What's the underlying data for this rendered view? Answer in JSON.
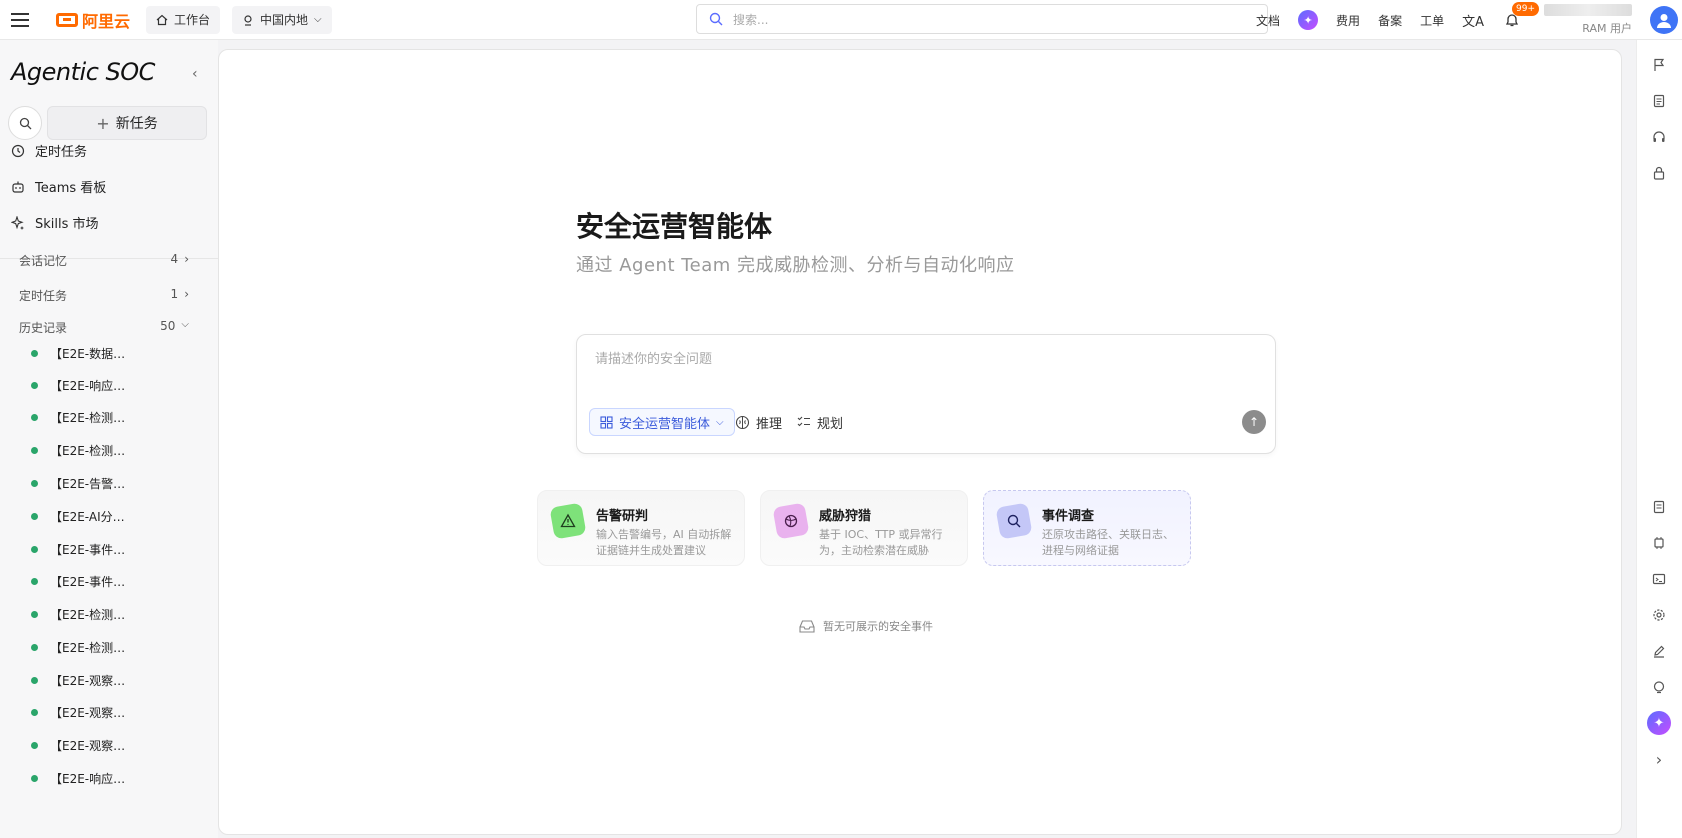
{
  "topbar": {
    "brand": "阿里云",
    "workbench": "工作台",
    "region": "中国内地",
    "search_placeholder": "搜索...",
    "links": [
      "文档",
      "费用",
      "备案",
      "工单"
    ],
    "notifications": "99+",
    "user_role": "RAM 用户"
  },
  "sidebar": {
    "title": "Agentic SOC",
    "new_task": "新任务",
    "nav": [
      {
        "label": "定时任务",
        "icon": "clock-icon"
      },
      {
        "label": "Teams 看板",
        "icon": "robot-icon"
      },
      {
        "label": "Skills 市场",
        "icon": "sparkle-icon"
      }
    ],
    "sections": [
      {
        "label": "会话记忆",
        "count": "4"
      },
      {
        "label": "定时任务",
        "count": "1"
      },
      {
        "label": "历史记录",
        "count": "50"
      }
    ],
    "history": [
      "【E2E-数据…",
      "【E2E-响应…",
      "【E2E-检测…",
      "【E2E-检测…",
      "【E2E-告警…",
      "【E2E-AI分…",
      "【E2E-事件…",
      "【E2E-事件…",
      "【E2E-检测…",
      "【E2E-检测…",
      "【E2E-观察…",
      "【E2E-观察…",
      "【E2E-观察…",
      "【E2E-响应…"
    ]
  },
  "main": {
    "title": "安全运营智能体",
    "subtitle": "通过 Agent Team 完成威胁检测、分析与自动化响应",
    "input_placeholder": "请描述你的安全问题",
    "agent_select": "安全运营智能体",
    "reasoning": "推理",
    "planning": "规划",
    "cards": [
      {
        "title": "告警研判",
        "desc": "输入告警编号，AI 自动拆解证据链并生成处置建议",
        "icon": "warning-icon",
        "color": "#7ee27a"
      },
      {
        "title": "威胁狩猎",
        "desc": "基于 IOC、TTP 或异常行为，主动检索潜在威胁",
        "icon": "globe-icon",
        "color": "#e9b2ee"
      },
      {
        "title": "事件调查",
        "desc": "还原攻击路径、关联日志、进程与网络证据",
        "icon": "search-icon",
        "color": "#c4c7f7"
      }
    ],
    "empty_note": "暂无可展示的安全事件"
  },
  "colors": {
    "brand": "#ff6a00",
    "accent": "#3b5bdb",
    "status_green": "#2aa56a"
  }
}
